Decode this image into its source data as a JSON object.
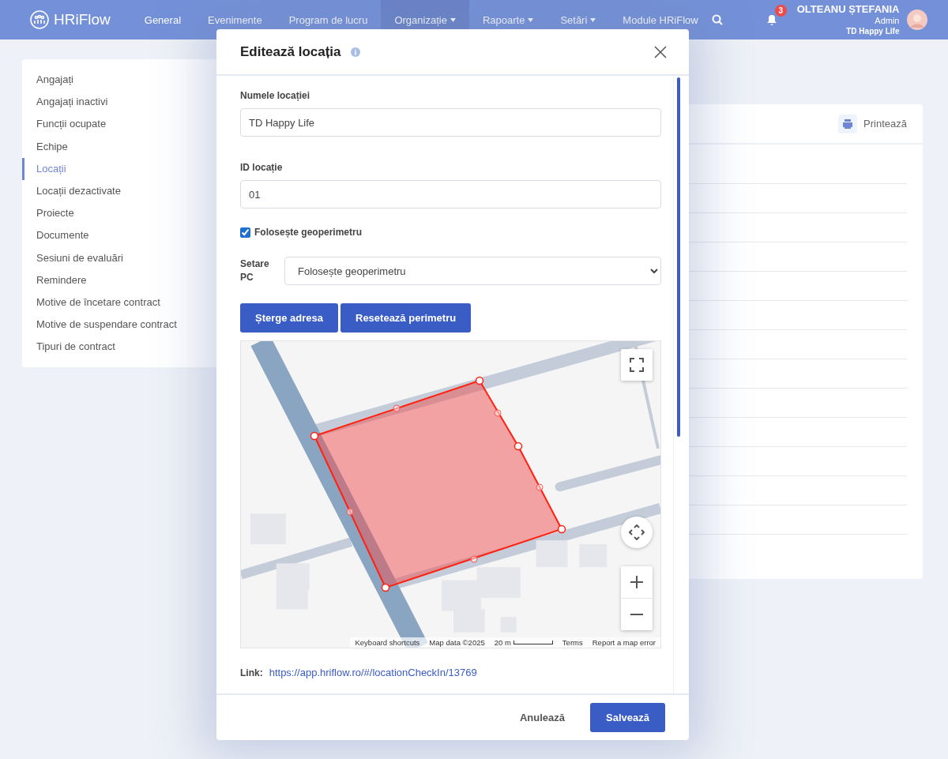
{
  "nav": {
    "logo": "HRiFlow",
    "items": [
      {
        "label": "General",
        "selected": false,
        "has_menu": false
      },
      {
        "label": "Evenimente",
        "selected": false,
        "has_menu": false
      },
      {
        "label": "Program de lucru",
        "selected": false,
        "has_menu": false
      },
      {
        "label": "Organizație",
        "selected": true,
        "has_menu": true
      },
      {
        "label": "Rapoarte",
        "selected": false,
        "has_menu": true
      },
      {
        "label": "Setări",
        "selected": false,
        "has_menu": true
      },
      {
        "label": "Module HRiFlow",
        "selected": false,
        "has_menu": false
      }
    ],
    "notifications": "3",
    "user": {
      "name": "OLTEANU ȘTEFANIA",
      "role": "Admin",
      "company": "TD Happy Life"
    }
  },
  "sidebar": {
    "items": [
      {
        "label": "Angajați",
        "selected": false
      },
      {
        "label": "Angajați inactivi",
        "selected": false
      },
      {
        "label": "Funcții ocupate",
        "selected": false
      },
      {
        "label": "Echipe",
        "selected": false
      },
      {
        "label": "Locații",
        "selected": true
      },
      {
        "label": "Locații dezactivate",
        "selected": false
      },
      {
        "label": "Proiecte",
        "selected": false
      },
      {
        "label": "Documente",
        "selected": false
      },
      {
        "label": "Sesiuni de evaluări",
        "selected": false
      },
      {
        "label": "Remindere",
        "selected": false
      },
      {
        "label": "Motive de încetare contract",
        "selected": false
      },
      {
        "label": "Motive de suspendare contract",
        "selected": false
      },
      {
        "label": "Tipuri de contract",
        "selected": false
      }
    ]
  },
  "panel": {
    "print_button": "Printează"
  },
  "modal": {
    "title": "Editează locația",
    "fields": [
      {
        "label": "Numele locației",
        "value": "TD Happy Life"
      },
      {
        "label": "ID locație",
        "value": "01"
      }
    ],
    "geofence": {
      "label": "Folosește geoperimetru",
      "checked": true
    },
    "pc_setting": {
      "label": "Setare PC",
      "value": "Folosește geoperimetru"
    },
    "buttons": [
      "Șterge adresa",
      "Resetează perimetru"
    ],
    "map": {
      "attribution": [
        "Keyboard shortcuts",
        "Map data ©2025",
        "20 m",
        "Terms",
        "Report a map error"
      ]
    },
    "link": {
      "label": "Link:",
      "url": "https://app.hriflow.ro/#/locationCheckIn/13769"
    },
    "footer": {
      "cancel": "Anulează",
      "save": "Salvează"
    }
  }
}
